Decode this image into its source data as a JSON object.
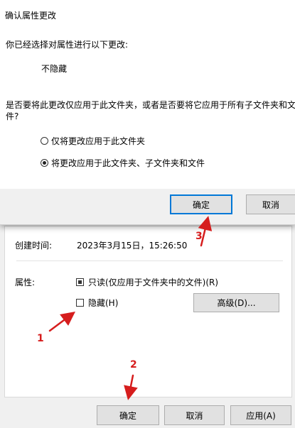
{
  "dialog": {
    "title": "确认属性更改",
    "intro": "你已经选择对属性进行以下更改:",
    "change": "不隐藏",
    "question_line1": "是否要将此更改仅应用于此文件夹，或者是否要将它应用于所有子文件夹和文",
    "question_line2": "件?",
    "options": [
      {
        "label": "仅将更改应用于此文件夹",
        "checked": false
      },
      {
        "label": "将更改应用于此文件夹、子文件夹和文件",
        "checked": true
      }
    ],
    "ok_label": "确定",
    "cancel_label": "取消"
  },
  "properties": {
    "created_label": "创建时间:",
    "created_value": "2023年3月15日，15:26:50",
    "attributes_label": "属性:",
    "readonly_label": "只读(仅应用于文件夹中的文件)(R)",
    "hidden_label": "隐藏(H)",
    "advanced_label": "高级(D)...",
    "ok_label": "确定",
    "cancel_label": "取消",
    "apply_label": "应用(A)"
  },
  "annotations": {
    "step1": "1",
    "step2": "2",
    "step3": "3",
    "color": "#d61d1d"
  },
  "colors": {
    "accent": "#0078d7"
  }
}
